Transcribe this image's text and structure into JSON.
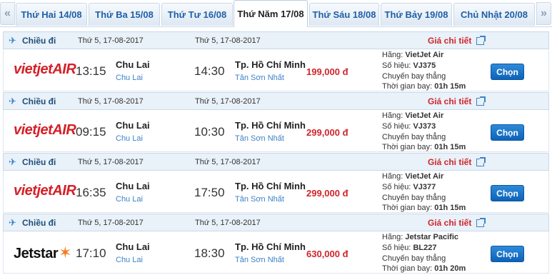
{
  "tabs": [
    {
      "label": "Thứ Hai 14/08"
    },
    {
      "label": "Thứ Ba 15/08"
    },
    {
      "label": "Thứ Tư 16/08"
    },
    {
      "label": "Thứ Năm 17/08"
    },
    {
      "label": "Thứ Sáu 18/08"
    },
    {
      "label": "Thứ Bảy 19/08"
    },
    {
      "label": "Chủ Nhật 20/08"
    }
  ],
  "flights": [
    {
      "direction": "Chiều đi",
      "dep_date": "Thứ 5, 17-08-2017",
      "arr_date": "Thứ 5, 17-08-2017",
      "detail_label": "Giá chi tiết",
      "airline_logo": "VietJet Air",
      "dep_time": "13:15",
      "dep_city": "Chu Lai",
      "dep_airport": "Chu Lai",
      "arr_time": "14:30",
      "arr_city": "Tp. Hồ Chí Minh",
      "arr_airport": "Tân Sơn Nhất",
      "price": "199,000 đ",
      "airline_label": "Hãng:",
      "airline": "VietJet Air",
      "flight_no_label": "Số hiệu:",
      "flight_no": "VJ375",
      "type": "Chuyến bay thẳng",
      "duration_label": "Thời gian bay:",
      "duration": "01h 15m",
      "button": "Chọn"
    },
    {
      "direction": "Chiều đi",
      "dep_date": "Thứ 5, 17-08-2017",
      "arr_date": "Thứ 5, 17-08-2017",
      "detail_label": "Giá chi tiết",
      "airline_logo": "VietJet Air",
      "dep_time": "09:15",
      "dep_city": "Chu Lai",
      "dep_airport": "Chu Lai",
      "arr_time": "10:30",
      "arr_city": "Tp. Hồ Chí Minh",
      "arr_airport": "Tân Sơn Nhất",
      "price": "299,000 đ",
      "airline_label": "Hãng:",
      "airline": "VietJet Air",
      "flight_no_label": "Số hiệu:",
      "flight_no": "VJ373",
      "type": "Chuyến bay thẳng",
      "duration_label": "Thời gian bay:",
      "duration": "01h 15m",
      "button": "Chọn"
    },
    {
      "direction": "Chiều đi",
      "dep_date": "Thứ 5, 17-08-2017",
      "arr_date": "Thứ 5, 17-08-2017",
      "detail_label": "Giá chi tiết",
      "airline_logo": "VietJet Air",
      "dep_time": "16:35",
      "dep_city": "Chu Lai",
      "dep_airport": "Chu Lai",
      "arr_time": "17:50",
      "arr_city": "Tp. Hồ Chí Minh",
      "arr_airport": "Tân Sơn Nhất",
      "price": "299,000 đ",
      "airline_label": "Hãng:",
      "airline": "VietJet Air",
      "flight_no_label": "Số hiệu:",
      "flight_no": "VJ377",
      "type": "Chuyến bay thẳng",
      "duration_label": "Thời gian bay:",
      "duration": "01h 15m",
      "button": "Chọn"
    },
    {
      "direction": "Chiều đi",
      "dep_date": "Thứ 5, 17-08-2017",
      "arr_date": "Thứ 5, 17-08-2017",
      "detail_label": "Giá chi tiết",
      "airline_logo": "Jetstar",
      "dep_time": "17:10",
      "dep_city": "Chu Lai",
      "dep_airport": "Chu Lai",
      "arr_time": "18:30",
      "arr_city": "Tp. Hồ Chí Minh",
      "arr_airport": "Tân Sơn Nhất",
      "price": "630,000 đ",
      "airline_label": "Hãng:",
      "airline": "Jetstar Pacific",
      "flight_no_label": "Số hiệu:",
      "flight_no": "BL227",
      "type": "Chuyến bay thẳng",
      "duration_label": "Thời gian bay:",
      "duration": "01h 20m",
      "button": "Chọn"
    }
  ],
  "icons": {
    "prev": "double-chevron-left-icon",
    "next": "double-chevron-right-icon",
    "plane": "airplane-icon",
    "external": "external-link-icon"
  },
  "colors": {
    "accent": "#1f5fa8",
    "price": "#d0252a",
    "button": "#0d62b8",
    "header_bg": "#e9f1f9"
  }
}
